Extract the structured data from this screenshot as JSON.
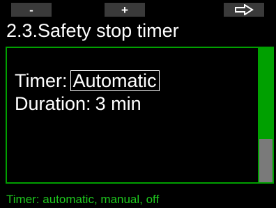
{
  "softkeys": {
    "minus_label": "-",
    "plus_label": "+",
    "next_icon": "arrow-right-icon"
  },
  "screen": {
    "title": "2.3.Safety stop timer"
  },
  "settings": {
    "timer_label": "Timer:",
    "timer_value": "Automatic",
    "duration_label": "Duration:",
    "duration_value": "3 min"
  },
  "scroll": {
    "position_fraction": 0.68
  },
  "help": {
    "text": "Timer: automatic, manual, off"
  },
  "colors": {
    "background": "#000000",
    "accent_green": "#00a000",
    "help_green": "#1ec81e",
    "softkey_bg": "#3a3a3a",
    "scrollbar_track": "#7a7a7a"
  }
}
